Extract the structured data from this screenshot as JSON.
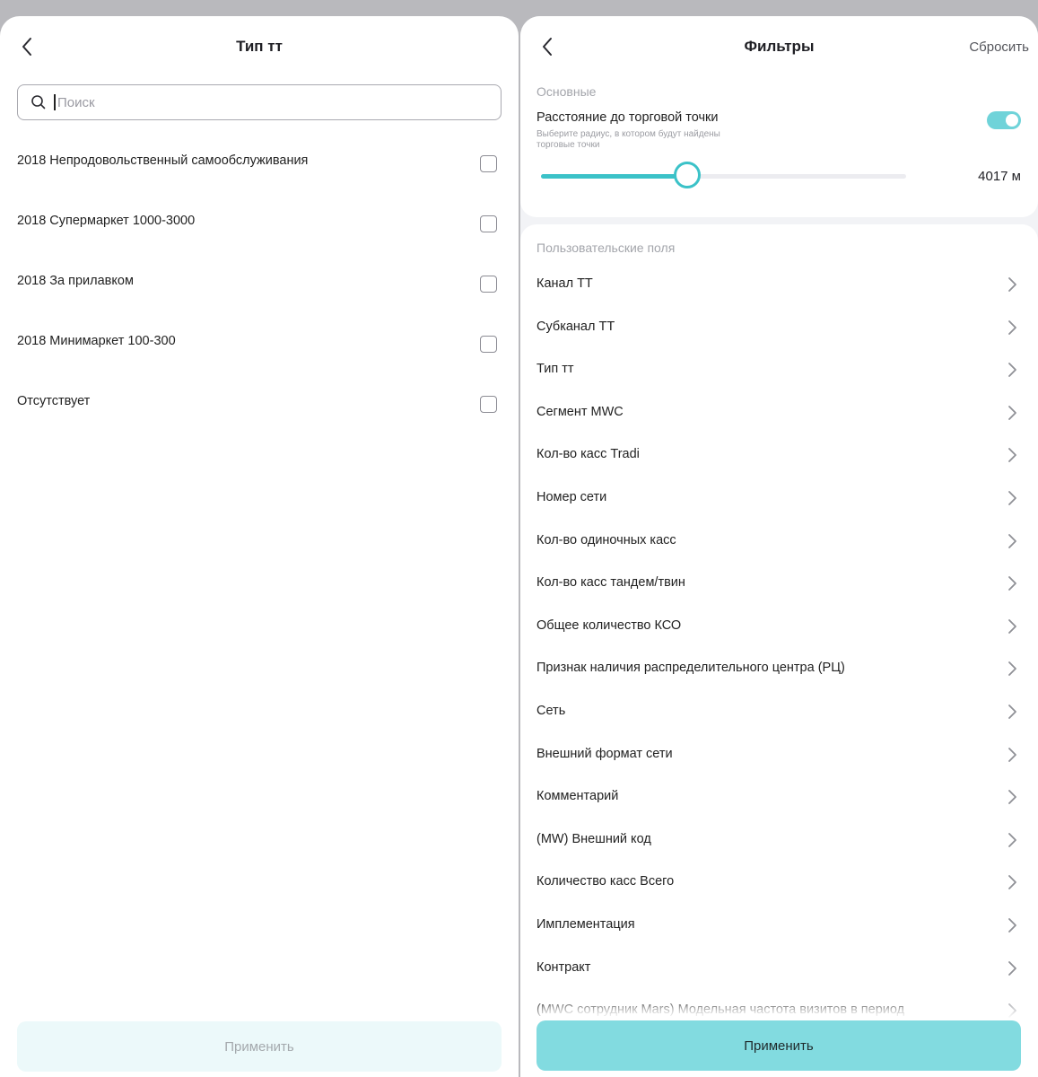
{
  "left": {
    "title": "Тип тт",
    "search_placeholder": "Поиск",
    "options": [
      {
        "label": "2018 Непродовольственный самообслуживания",
        "checked": false
      },
      {
        "label": "2018 Супермаркет 1000-3000",
        "checked": false
      },
      {
        "label": "2018 За прилавком",
        "checked": false
      },
      {
        "label": "2018 Минимаркет 100-300",
        "checked": false
      },
      {
        "label": "Отсутствует",
        "checked": false
      }
    ],
    "apply_label": "Применить",
    "apply_enabled": false
  },
  "right": {
    "title": "Фильтры",
    "reset_label": "Сбросить",
    "basic_section": "Основные",
    "distance": {
      "title": "Расстояние до торговой точки",
      "hint": "Выберите радиус, в котором будут найдены торговые точки",
      "enabled": true,
      "value_label": "4017 м",
      "slider_fraction": 0.4
    },
    "custom_section": "Пользовательские поля",
    "fields": [
      "Канал ТТ",
      "Субканал ТТ",
      "Тип тт",
      "Сегмент MWC",
      "Кол-во касс Tradi",
      "Номер сети",
      "Кол-во одиночных касс",
      "Кол-во касс тандем/твин",
      "Общее количество КСО",
      "Признак наличия распределительного центра (РЦ)",
      "Сеть",
      "Внешний формат сети",
      "Комментарий",
      "(MW) Внешний код",
      "Количество касс Всего",
      "Имплементация",
      "Контракт",
      "(MWC сотрудник Mars) Модельная частота визитов в период"
    ],
    "apply_label": "Применить"
  },
  "colors": {
    "accent": "#3bc2c8",
    "button_active": "#82dbe0",
    "button_disabled": "#ecf9fa"
  }
}
